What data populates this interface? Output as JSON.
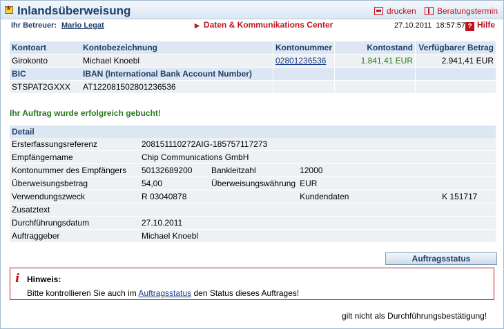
{
  "header": {
    "title": "Inlandsüberweisung",
    "print_label": "drucken",
    "appointment_label": "Beratungstermin"
  },
  "subheader": {
    "advisor_label": "Ihr Betreuer:",
    "advisor_name": "Mario Legat",
    "center_link": "Daten & Kommunikations Center",
    "datetime": "27.10.2011  18:57:57",
    "help_label": "Hilfe"
  },
  "account": {
    "headers": [
      "Kontoart",
      "Kontobezeichnung",
      "Kontonummer",
      "Kontostand",
      "Verfügbarer Betrag"
    ],
    "row": [
      "Girokonto",
      "Michael Knoebl",
      "02801236536",
      "1.841,41 EUR",
      "2.941,41 EUR"
    ],
    "bic_label": "BIC",
    "iban_label": "IBAN (International Bank Account Number)",
    "bic": "STSPAT2GXXX",
    "iban": "AT122081502801236536"
  },
  "status_message": "Ihr Auftrag wurde erfolgreich gebucht!",
  "detail": {
    "title": "Detail",
    "ref_label": "Ersterfassungsreferenz",
    "ref_value": "208151110272AIG-185757117273",
    "recipient_label": "Empfängername",
    "recipient_value": "Chip Communications GmbH",
    "acctno_label": "Kontonummer des Empfängers",
    "acctno_value": "50132689200",
    "blz_label": "Bankleitzahl",
    "blz_value": "12000",
    "amount_label": "Überweisungsbetrag",
    "amount_value": "54,00",
    "currency_label": "Überweisungswährung",
    "currency_value": "EUR",
    "purpose_label": "Verwendungszweck",
    "purpose_value": "R 03040878",
    "customer_label": "Kundendaten",
    "customer_value": "K 151717",
    "extra_label": "Zusatztext",
    "date_label": "Durchführungsdatum",
    "date_value": "27.10.2011",
    "orderer_label": "Auftraggeber",
    "orderer_value": "Michael Knoebl"
  },
  "status_button": "Auftragsstatus",
  "notice": {
    "title": "Hinweis:",
    "text_before": "Bitte kontrollieren Sie auch im ",
    "link": "Auftragsstatus",
    "text_after": " den Status dieses Auftrages!"
  },
  "footer": "gilt nicht als Durchführungsbestätigung!",
  "colors": {
    "accent_red": "#c0141c",
    "header_blue": "#1d3f6a",
    "balance_green": "#2a7a1f"
  }
}
